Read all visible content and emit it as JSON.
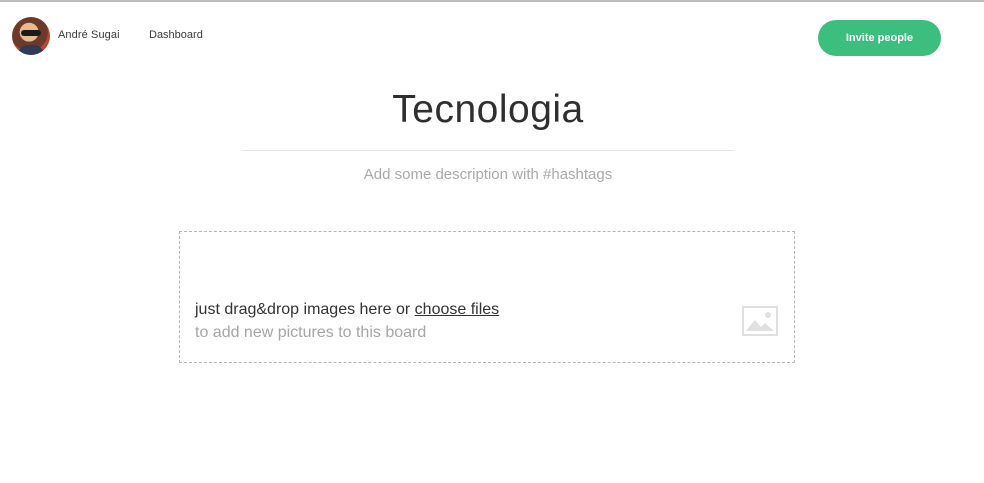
{
  "header": {
    "user_name": "André Sugai",
    "nav_dashboard": "Dashboard",
    "invite_label": "Invite people"
  },
  "board": {
    "title": "Tecnologia",
    "description_placeholder": "Add some description with #hashtags"
  },
  "dropzone": {
    "line1_prefix": "just drag&drop images here or ",
    "choose_files_link": "choose files",
    "line2": "to add new pictures to this board",
    "icon": "image-icon"
  },
  "colors": {
    "accent": "#3cbf7d",
    "text": "#333333",
    "muted": "#a9a9a9"
  }
}
